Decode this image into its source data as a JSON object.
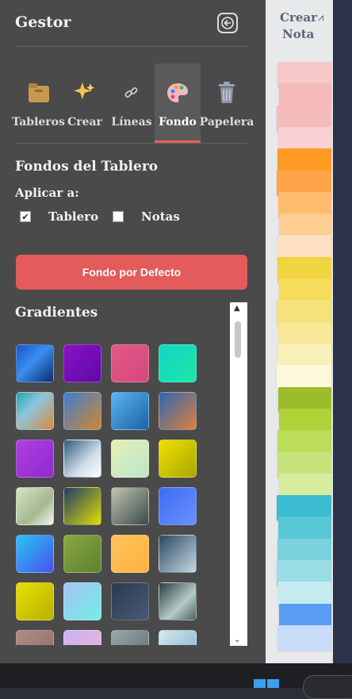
{
  "panel": {
    "title": "Gestor",
    "tabs": [
      {
        "label": "Tableros",
        "icon": "board-folder-icon"
      },
      {
        "label": "Crear",
        "icon": "sparkles-icon"
      },
      {
        "label": "Líneas",
        "icon": "link-icon"
      },
      {
        "label": "Fondo",
        "icon": "palette-icon",
        "active": true
      },
      {
        "label": "Papelera",
        "icon": "trash-icon"
      }
    ],
    "section_title": "Fondos del Tablero",
    "apply_label": "Aplicar a:",
    "checks": [
      {
        "label": "Tablero",
        "checked": true
      },
      {
        "label": "Notas",
        "checked": false
      }
    ],
    "default_button": "Fondo por Defecto",
    "gradients_title": "Gradientes",
    "accent_color": "#e45b5b"
  },
  "gradients": [
    "linear-gradient(135deg,#1b56c9,#3a8ef0 45%,#0d2a6a)",
    "linear-gradient(135deg,#8a12c7,#5e0aa3)",
    "linear-gradient(135deg,#e05a86,#d7477d)",
    "linear-gradient(135deg,#10d6c5,#1fe6a8)",
    "linear-gradient(135deg,#23a0b0,#8ac6e0 40%,#d98a3c)",
    "linear-gradient(135deg,#3b7fd6,#d1872e)",
    "linear-gradient(135deg,#5ab6f0,#1d5fa6)",
    "linear-gradient(135deg,#2b66b5,#e0803a)",
    "linear-gradient(135deg,#b03fe0,#8d2bd0)",
    "linear-gradient(135deg,#2e5a80,#d0dde8 60%,#ffffff)",
    "linear-gradient(135deg,#e8f0b8,#b8e6c8)",
    "linear-gradient(135deg,#f0e000,#a8a800)",
    "linear-gradient(135deg,#d8e4c8,#a4b890 60%,#f4f8f0)",
    "linear-gradient(135deg,#1e3a6a,#e0e000)",
    "linear-gradient(135deg,#c0c6b0,#3a4a48)",
    "linear-gradient(135deg,#3b6cf4,#6a90ff)",
    "linear-gradient(135deg,#28c6f0,#4a50f0)",
    "linear-gradient(135deg,#8aa840,#5c8030)",
    "linear-gradient(135deg,#ffc45a,#ffb040)",
    "linear-gradient(135deg,#2a4860,#c8d8e4)",
    "linear-gradient(135deg,#e6e000,#b8b000)",
    "linear-gradient(135deg,#a8c0f8,#70f0e0)",
    "linear-gradient(135deg,#2a3a52,#4a5a74)",
    "linear-gradient(135deg,#2a3a44,#b4ccc4 60%,#50606a)",
    "linear-gradient(135deg,#b08c84,#8e6c66)",
    "linear-gradient(135deg,#c8b0f0,#f0b8d8)",
    "linear-gradient(135deg,#9aa8a8,#5a6a70)",
    "linear-gradient(135deg,#d8e8f0,#7ab0c8)"
  ],
  "right": {
    "label_line1": "Crear",
    "label_line2": "Nota",
    "notes": [
      "#f6c8c8",
      "#f5b9b9",
      "#f6bcbc",
      "#fbd0d4",
      "#ff9a24",
      "#ffa448",
      "#ffbb6e",
      "#ffcc94",
      "#ffe0c2",
      "#f0d440",
      "#f5dd5a",
      "#f5e27a",
      "#f8e898",
      "#f8f0b8",
      "#fdf8dc",
      "#9cbc2c",
      "#aed238",
      "#bcdc5a",
      "#c8e27c",
      "#d8eca0",
      "#3cbcd0",
      "#58c8d8",
      "#7ad2de",
      "#9adde6",
      "#c6ecf2",
      "#5a9cf4",
      "#c8dcf8"
    ]
  }
}
